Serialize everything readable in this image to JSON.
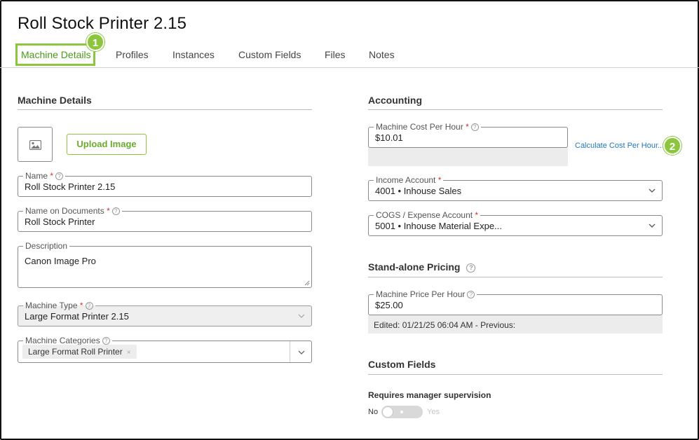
{
  "page": {
    "title": "Roll Stock Printer 2.15"
  },
  "tabs": [
    {
      "label": "Machine Details"
    },
    {
      "label": "Profiles"
    },
    {
      "label": "Instances"
    },
    {
      "label": "Custom Fields"
    },
    {
      "label": "Files"
    },
    {
      "label": "Notes"
    }
  ],
  "callouts": {
    "first": "1",
    "second": "2"
  },
  "machine_details": {
    "heading": "Machine Details",
    "image_icon": "image-icon",
    "upload_button": "Upload Image",
    "name": {
      "label": "Name",
      "required": "*",
      "value": "Roll Stock Printer 2.15"
    },
    "name_on_documents": {
      "label": "Name on Documents",
      "required": "*",
      "value": "Roll Stock Printer"
    },
    "description": {
      "label": "Description",
      "value": "Canon Image Pro"
    },
    "machine_type": {
      "label": "Machine Type",
      "required": "*",
      "value": "Large Format Printer 2.15"
    },
    "machine_categories": {
      "label": "Machine Categories",
      "tag": "Large Format Roll Printer",
      "tag_remove": "×"
    }
  },
  "accounting": {
    "heading": "Accounting",
    "cost_per_hour": {
      "label": "Machine Cost Per Hour",
      "required": "*",
      "value": "$10.01"
    },
    "calculate_link": "Calculate Cost Per Hour...",
    "income_account": {
      "label": "Income Account",
      "required": "*",
      "value": "4001 • Inhouse Sales"
    },
    "cogs_account": {
      "label": "COGS / Expense Account",
      "required": "*",
      "value": "5001 • Inhouse Material Expe..."
    }
  },
  "standalone_pricing": {
    "heading": "Stand-alone Pricing",
    "price_per_hour": {
      "label": "Machine Price Per Hour",
      "value": "$25.00"
    },
    "edited_note": "Edited: 01/21/25 06:04 AM - Previous:"
  },
  "custom_fields": {
    "heading": "Custom Fields",
    "supervision": {
      "label": "Requires manager supervision",
      "off_label": "No",
      "on_label": "Yes",
      "value": "No"
    }
  },
  "colors": {
    "accent": "#8cc63f",
    "link": "#1f79b8",
    "required": "#d32f2f"
  },
  "help_glyph": "?"
}
